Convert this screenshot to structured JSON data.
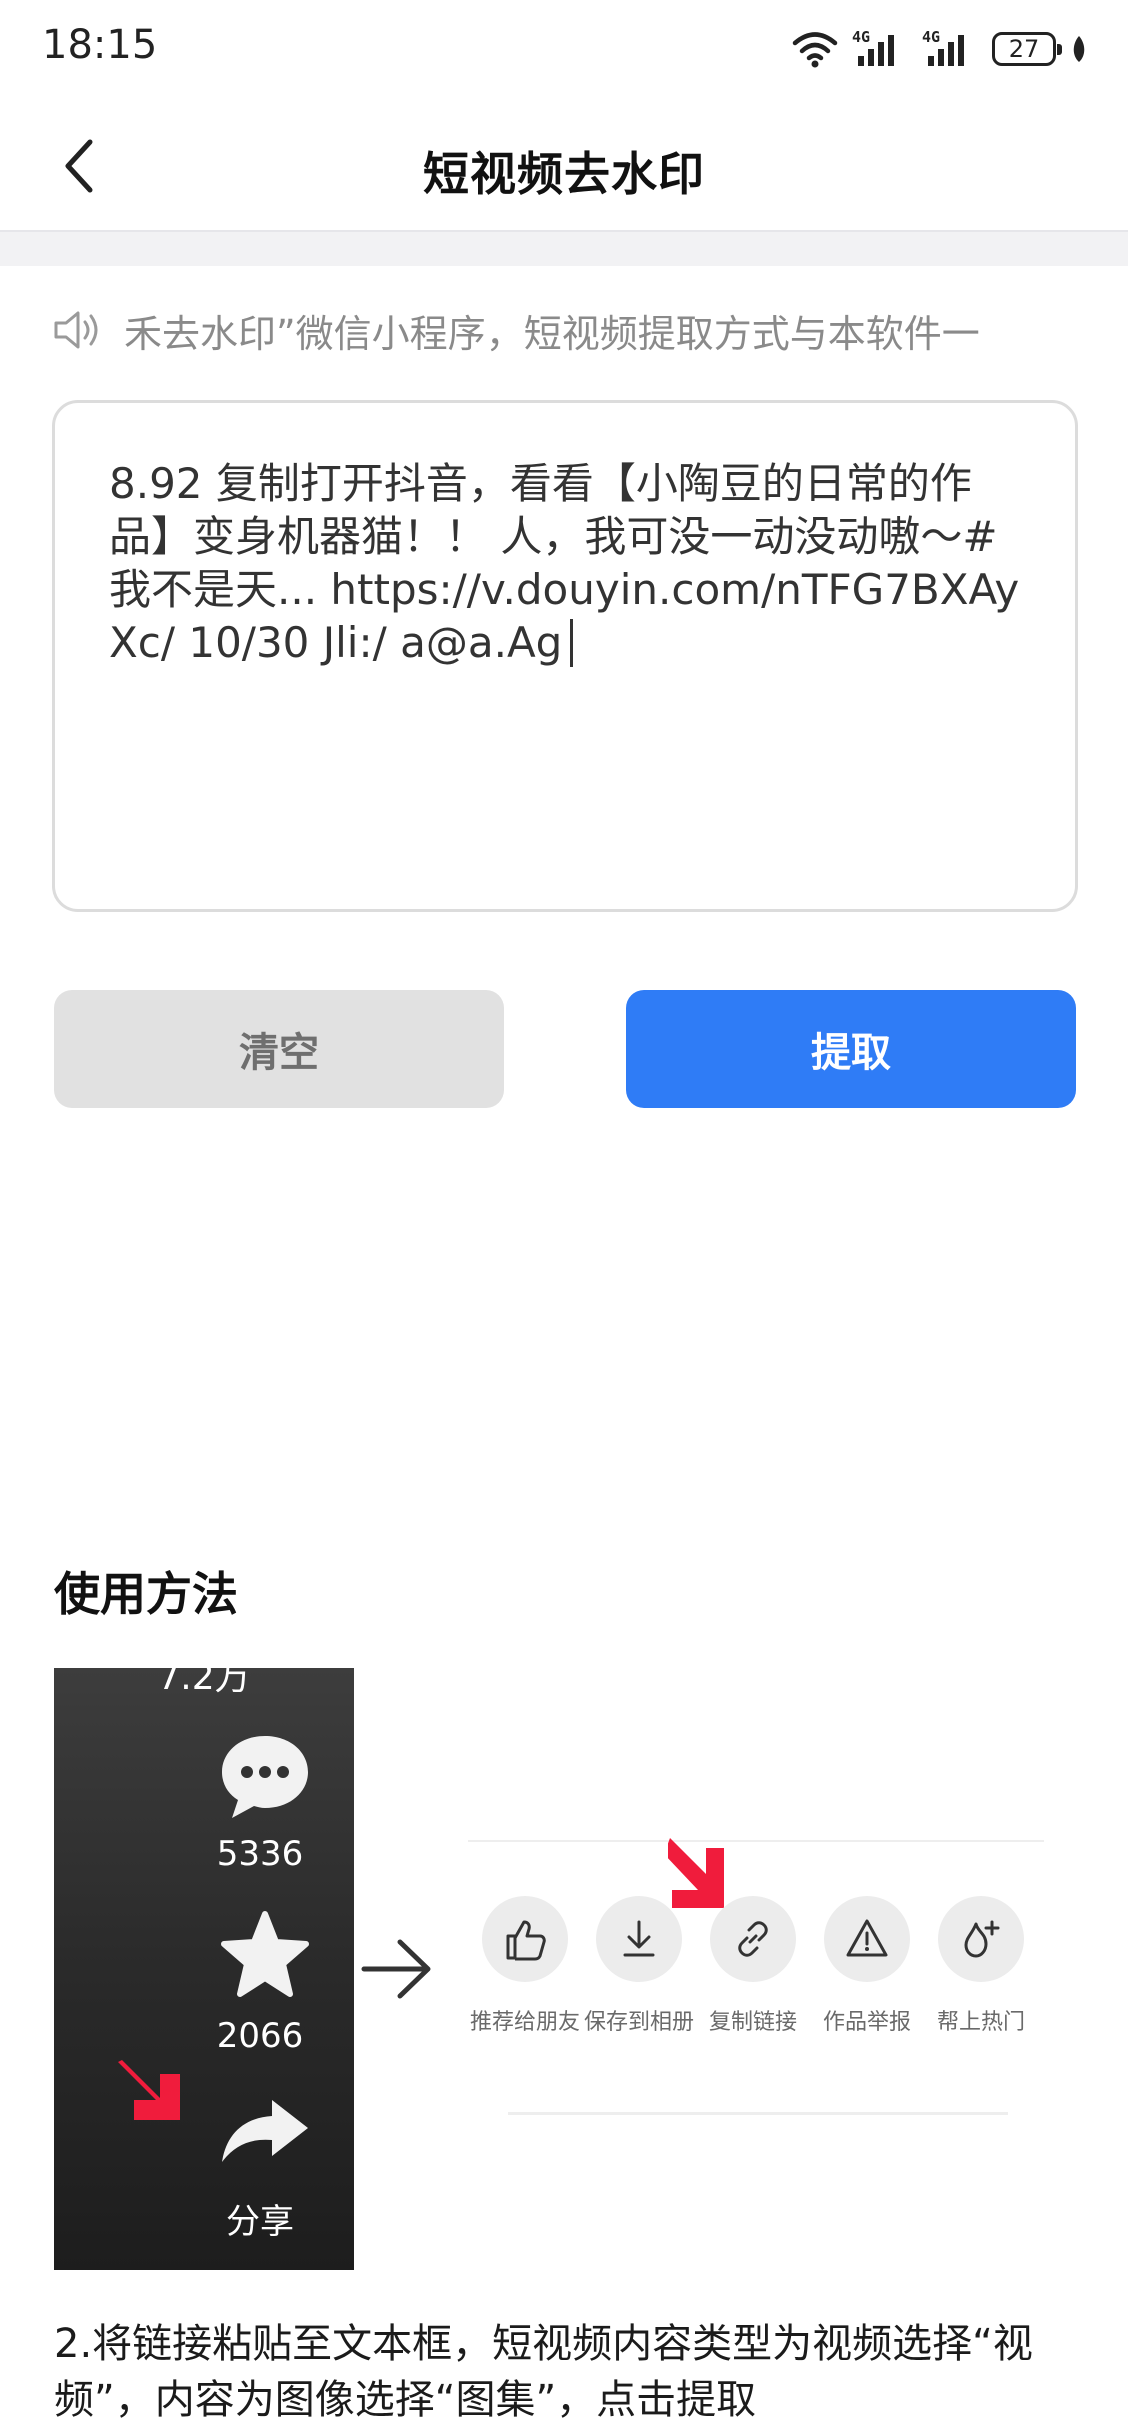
{
  "status_bar": {
    "time": "18:15",
    "signal1": "4G",
    "signal2": "4G",
    "battery": "27"
  },
  "header": {
    "title": "短视频去水印"
  },
  "notice": {
    "text": "禾去水印”微信小程序，短视频提取方式与本软件一"
  },
  "input": {
    "value": "8.92 复制打开抖音，看看【小陶豆的日常的作品】变身机器猫！！ 人，我可没一动没动嗷～# 我不是天... https://v.douyin.com/nTFG7BXAyXc/ 10/30 Jli:/ a@a.Ag"
  },
  "buttons": {
    "clear_label": "清空",
    "extract_label": "提取"
  },
  "usage": {
    "title": "使用方法",
    "guide": {
      "top_count": "7.2万",
      "comment_count": "5336",
      "favorite_count": "2066",
      "share_label": "分享",
      "share_menu": [
        "推荐给朋友",
        "保存到相册",
        "复制链接",
        "作品举报",
        "帮上热门"
      ]
    },
    "step2": "2.将链接粘贴至文本框，短视频内容类型为视频选择“视频”，内容为图像选择“图集”，点击提取"
  }
}
